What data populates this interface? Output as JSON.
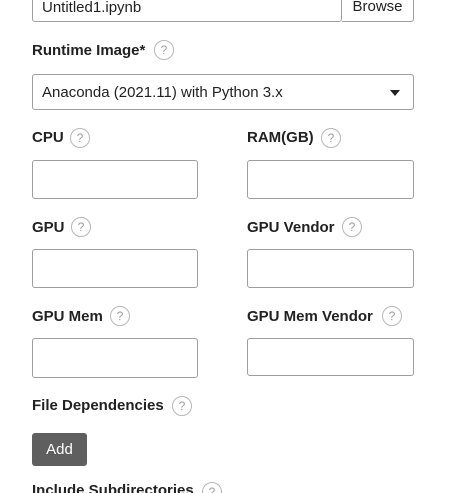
{
  "filename": {
    "value": "Untitled1.ipynb",
    "browse_label": "Browse"
  },
  "runtime_image": {
    "label": "Runtime Image*",
    "help_icon": "?",
    "selected": "Anaconda (2021.11) with Python 3.x"
  },
  "fields": {
    "cpu": {
      "label": "CPU",
      "help_icon": "?",
      "value": ""
    },
    "ram": {
      "label": "RAM(GB)",
      "help_icon": "?",
      "value": ""
    },
    "gpu": {
      "label": "GPU",
      "help_icon": "?",
      "value": ""
    },
    "gpu_vendor": {
      "label": "GPU Vendor",
      "help_icon": "?",
      "value": ""
    },
    "gpu_mem": {
      "label": "GPU Mem",
      "help_icon": "?",
      "value": ""
    },
    "gpu_mem_vendor": {
      "label": "GPU Mem Vendor",
      "help_icon": "?",
      "value": ""
    }
  },
  "file_dependencies": {
    "label": "File Dependencies",
    "help_icon": "?",
    "add_label": "Add"
  },
  "include_subdirectories": {
    "label": "Include Subdirectories",
    "help_icon": "?"
  }
}
